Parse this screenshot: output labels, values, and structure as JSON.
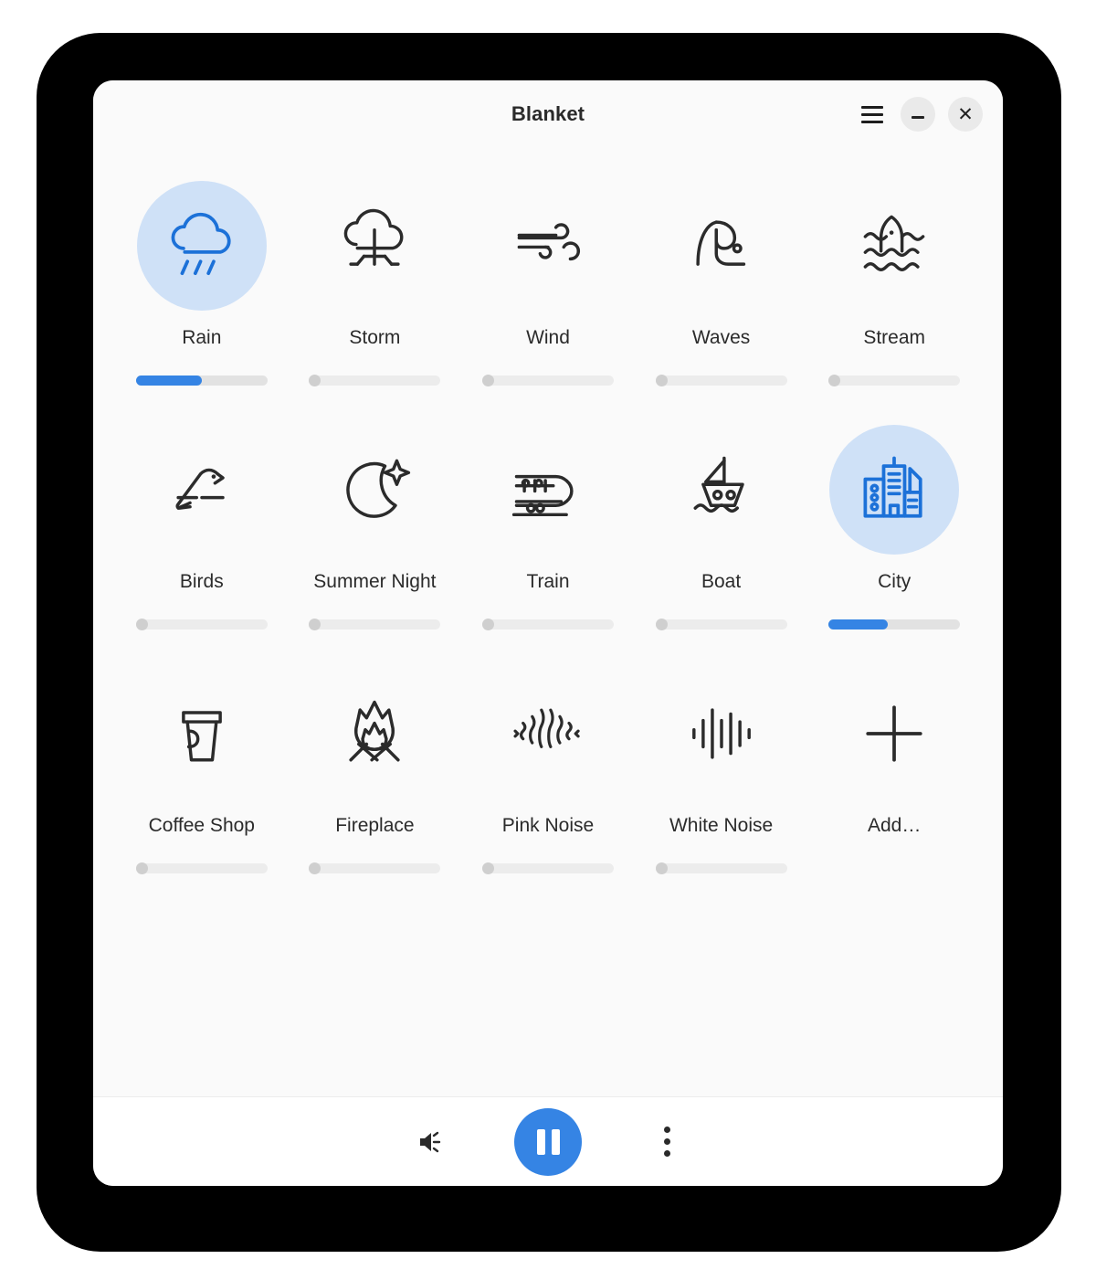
{
  "window": {
    "title": "Blanket",
    "accent_color": "#3584e4",
    "active_bg_color": "#cfe1f7",
    "background_color": "#fafafa",
    "controls": {
      "menu_label": "hamburger-menu",
      "minimize_label": "Minimize",
      "close_label": "Close"
    }
  },
  "sounds": [
    {
      "name": "Rain",
      "icon": "rain-icon",
      "active": true,
      "volume": 50,
      "has_slider": true
    },
    {
      "name": "Storm",
      "icon": "storm-icon",
      "active": false,
      "volume": 0,
      "has_slider": true
    },
    {
      "name": "Wind",
      "icon": "wind-icon",
      "active": false,
      "volume": 0,
      "has_slider": true
    },
    {
      "name": "Waves",
      "icon": "waves-icon",
      "active": false,
      "volume": 0,
      "has_slider": true
    },
    {
      "name": "Stream",
      "icon": "stream-icon",
      "active": false,
      "volume": 0,
      "has_slider": true
    },
    {
      "name": "Birds",
      "icon": "birds-icon",
      "active": false,
      "volume": 0,
      "has_slider": true
    },
    {
      "name": "Summer Night",
      "icon": "summer-night-icon",
      "active": false,
      "volume": 0,
      "has_slider": true
    },
    {
      "name": "Train",
      "icon": "train-icon",
      "active": false,
      "volume": 0,
      "has_slider": true
    },
    {
      "name": "Boat",
      "icon": "boat-icon",
      "active": false,
      "volume": 0,
      "has_slider": true
    },
    {
      "name": "City",
      "icon": "city-icon",
      "active": true,
      "volume": 45,
      "has_slider": true
    },
    {
      "name": "Coffee Shop",
      "icon": "coffee-shop-icon",
      "active": false,
      "volume": 0,
      "has_slider": true
    },
    {
      "name": "Fireplace",
      "icon": "fireplace-icon",
      "active": false,
      "volume": 0,
      "has_slider": true
    },
    {
      "name": "Pink Noise",
      "icon": "pink-noise-icon",
      "active": false,
      "volume": 0,
      "has_slider": true
    },
    {
      "name": "White Noise",
      "icon": "white-noise-icon",
      "active": false,
      "volume": 0,
      "has_slider": true
    },
    {
      "name": "Add…",
      "icon": "plus-icon",
      "active": false,
      "volume": 0,
      "has_slider": false
    }
  ],
  "bottom_bar": {
    "volume_icon": "volume-icon",
    "playback_icon": "pause-icon",
    "playback_state": "playing",
    "menu_icon": "three-dots-vertical-icon"
  }
}
